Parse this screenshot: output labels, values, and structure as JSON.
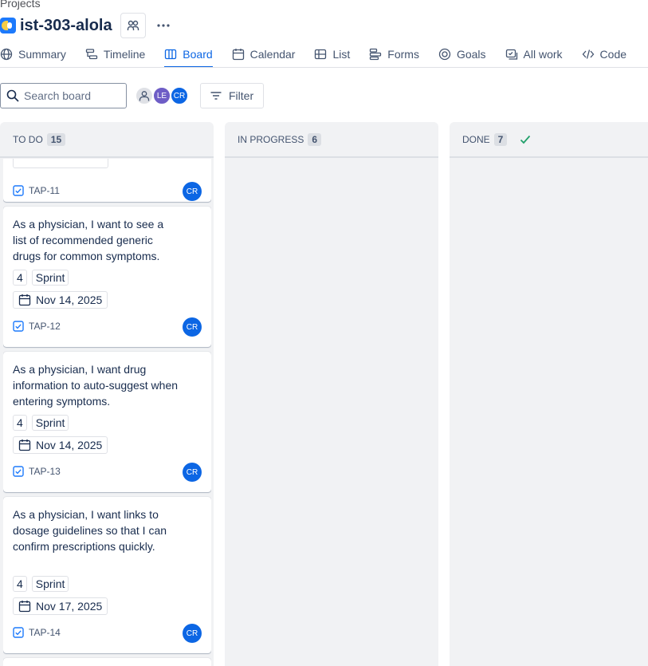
{
  "breadcrumb": "Projects",
  "project": {
    "title": "ist-303-alola"
  },
  "tabs": [
    {
      "label": "Summary",
      "icon": "globe-icon"
    },
    {
      "label": "Timeline",
      "icon": "timeline-icon"
    },
    {
      "label": "Board",
      "icon": "board-icon",
      "active": true
    },
    {
      "label": "Calendar",
      "icon": "calendar-icon"
    },
    {
      "label": "List",
      "icon": "list-icon"
    },
    {
      "label": "Forms",
      "icon": "forms-icon"
    },
    {
      "label": "Goals",
      "icon": "goals-icon"
    },
    {
      "label": "All work",
      "icon": "all-work-icon"
    },
    {
      "label": "Code",
      "icon": "code-icon"
    }
  ],
  "toolbar": {
    "search_placeholder": "Search board",
    "avatars": [
      "",
      "LE",
      "CR"
    ],
    "filter_label": "Filter"
  },
  "columns": [
    {
      "name": "TO DO",
      "count": "15"
    },
    {
      "name": "IN PROGRESS",
      "count": "6"
    },
    {
      "name": "DONE",
      "count": "7"
    }
  ],
  "cards": [
    {
      "key": "TAP-11",
      "assignee": "CR"
    },
    {
      "summary": "As a physician, I want to see a list of recommended generic drugs for common symptoms.",
      "points": "4",
      "label": "Sprint",
      "date": "Nov 14, 2025",
      "key": "TAP-12",
      "assignee": "CR"
    },
    {
      "summary": "As a physician, I want drug information to auto-suggest when entering symptoms.",
      "points": "4",
      "label": "Sprint",
      "date": "Nov 14, 2025",
      "key": "TAP-13",
      "assignee": "CR"
    },
    {
      "summary": "As a physician, I want links to dosage guidelines so that I can confirm prescriptions quickly.",
      "points": "4",
      "label": "Sprint",
      "date": "Nov 17, 2025",
      "key": "TAP-14",
      "assignee": "CR"
    }
  ],
  "colors": {
    "accent": "#0c66e4",
    "done_check": "#22a06b",
    "column_bg": "#f1f2f4"
  }
}
